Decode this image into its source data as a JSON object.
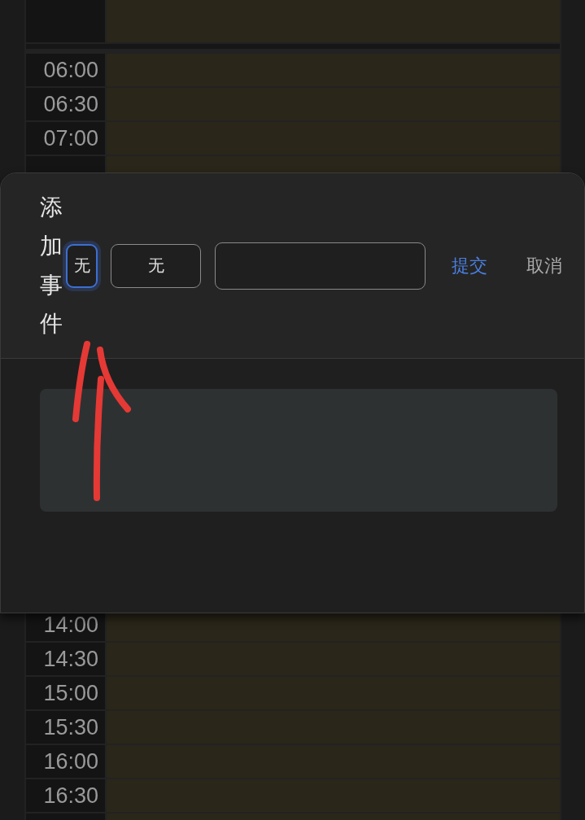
{
  "calendar": {
    "time_slots_top": [
      "06:00",
      "06:30",
      "07:00"
    ],
    "time_slots_bottom": [
      "14:00",
      "14:30",
      "15:00",
      "15:30",
      "16:00",
      "16:30"
    ]
  },
  "dialog": {
    "title": "添加事件",
    "selectors": [
      {
        "label": "无",
        "selected": true
      },
      {
        "label": "无",
        "selected": false
      }
    ],
    "submit": "提交",
    "cancel": "取消"
  },
  "annotation": {
    "kind": "arrow"
  }
}
